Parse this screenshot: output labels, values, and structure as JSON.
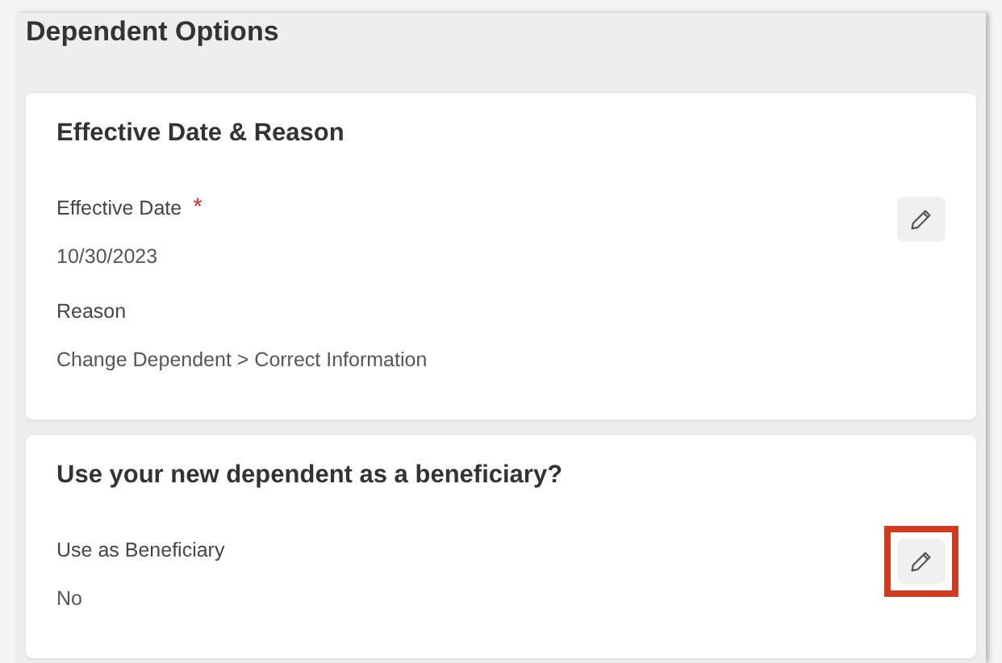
{
  "panel": {
    "title": "Dependent Options"
  },
  "cards": [
    {
      "title": "Effective Date & Reason",
      "edit_highlighted": false,
      "fields": [
        {
          "label": "Effective Date",
          "required_mark": "*",
          "value": "10/30/2023"
        },
        {
          "label": "Reason",
          "value": "Change Dependent > Correct Information"
        }
      ]
    },
    {
      "title": "Use your new dependent as a beneficiary?",
      "edit_highlighted": true,
      "fields": [
        {
          "label": "Use as Beneficiary",
          "value": "No"
        }
      ]
    }
  ]
}
